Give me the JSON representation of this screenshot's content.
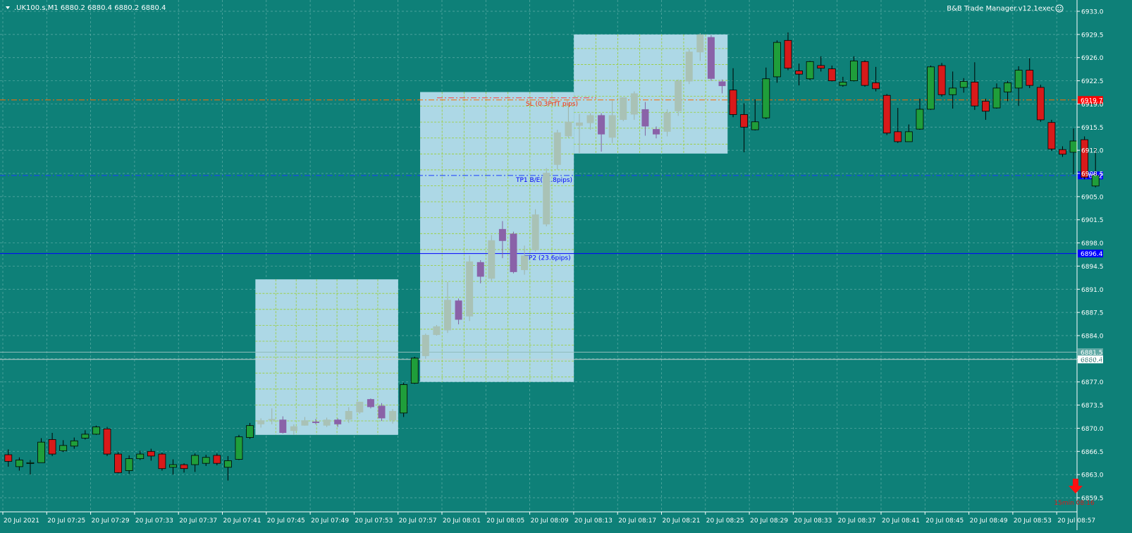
{
  "symbol_header": ".UK100.s,M1  6880.2 6880.4 6880.2 6880.4",
  "indicator_label": "B&B Trade Manager.v12.1exec",
  "price_ticks": [
    "6933.0",
    "6929.5",
    "6926.0",
    "6922.5",
    "6919.0",
    "6915.5",
    "6912.0",
    "6908.5",
    "6905.0",
    "6901.5",
    "6898.0",
    "6894.5",
    "6891.0",
    "6887.5",
    "6884.0",
    "6880.5",
    "6877.0",
    "6873.5",
    "6870.0",
    "6866.5",
    "6863.0",
    "6859.5"
  ],
  "time_labels": [
    "20 Jul 2021",
    "20 Jul 07:25",
    "20 Jul 07:29",
    "20 Jul 07:33",
    "20 Jul 07:37",
    "20 Jul 07:41",
    "20 Jul 07:45",
    "20 Jul 07:49",
    "20 Jul 07:53",
    "20 Jul 07:57",
    "20 Jul 08:01",
    "20 Jul 08:05",
    "20 Jul 08:09",
    "20 Jul 08:13",
    "20 Jul 08:17",
    "20 Jul 08:21",
    "20 Jul 08:25",
    "20 Jul 08:29",
    "20 Jul 08:33",
    "20 Jul 08:37",
    "20 Jul 08:41",
    "20 Jul 08:45",
    "20 Jul 08:49",
    "20 Jul 08:53",
    "20 Jul 08:57"
  ],
  "level_lines": [
    {
      "name": "sl-line",
      "price": 6919.6,
      "color": "#ff6a00",
      "style": "dashdot",
      "label": "SL (0.3PrfT pips)",
      "label_color": "#ff2a00",
      "tag": "6919.7",
      "tag_bg": "#ff0000"
    },
    {
      "name": "tp1-line",
      "price": 6908.2,
      "color": "#1a3cff",
      "style": "dashdot",
      "label": "TP1 B/E(11.8pips)",
      "label_color": "#0000ff",
      "tag": "6908.2",
      "tag_bg": "#0000ff"
    },
    {
      "name": "tp2-line",
      "price": 6896.4,
      "color": "#0000ff",
      "style": "solid",
      "label": "TP2 (23.6pips)",
      "label_color": "#0000ff",
      "tag": "6896.4",
      "tag_bg": "#0000ff"
    },
    {
      "name": "ask-line",
      "price": 6881.5,
      "color": "#8fbcbb",
      "style": "solid",
      "label": "",
      "tag": "6881.5",
      "tag_bg": "#5fa8a4"
    },
    {
      "name": "bid-line",
      "price": 6880.4,
      "color": "#c8d0d0",
      "style": "solid",
      "label": "",
      "tag": "6880.4",
      "tag_bg": "#ffffff"
    }
  ],
  "timer_text": "15min 08:16",
  "colors": {
    "background": "#0e8078",
    "bull": "#1f9e3a",
    "bear": "#d81a1a",
    "zone_fill": "#add8e6",
    "zone_bull": "#a9c2b6",
    "zone_bear": "#8a62a8",
    "axis_text": "#ffffff",
    "grid": "#9fd2ce",
    "zone_grid": "#9acd32"
  },
  "chart_data": {
    "type": "candlestick",
    "symbol": ".UK100.s",
    "timeframe": "M1",
    "ylim": [
      6859.5,
      6933.0
    ],
    "first_time": "07:22",
    "zones": [
      {
        "from": "07:45",
        "to": "07:57",
        "low": 6869.0,
        "high": 6892.5
      },
      {
        "from": "08:00",
        "to": "08:13",
        "low": 6877.0,
        "high": 6920.8
      },
      {
        "from": "08:14",
        "to": "08:27",
        "low": 6911.5,
        "high": 6929.5
      }
    ],
    "candles": [
      [
        6866,
        6865,
        6866.8,
        6864.2
      ],
      [
        6864.2,
        6865.2,
        6865.6,
        6863.6
      ],
      [
        6864.8,
        6864.8,
        6865.2,
        6863
      ],
      [
        6864.8,
        6867.9,
        6868.5,
        6864.8
      ],
      [
        6868.3,
        6866.1,
        6869.3,
        6865.8
      ],
      [
        6866.6,
        6867.4,
        6868.2,
        6866.4
      ],
      [
        6867.3,
        6868.1,
        6868.6,
        6866.9
      ],
      [
        6868.5,
        6869.1,
        6869.7,
        6868.3
      ],
      [
        6869.1,
        6870.2,
        6870.4,
        6869
      ],
      [
        6869.9,
        6866.1,
        6870.2,
        6865.8
      ],
      [
        6866.1,
        6863.3,
        6866.4,
        6863.2
      ],
      [
        6863.6,
        6865.4,
        6865.9,
        6863.1
      ],
      [
        6865.4,
        6866.1,
        6866.6,
        6865.2
      ],
      [
        6866.5,
        6865.8,
        6866.9,
        6865.1
      ],
      [
        6866.1,
        6863.9,
        6866.3,
        6863.6
      ],
      [
        6864.1,
        6864.5,
        6865.3,
        6863
      ],
      [
        6864.5,
        6863.9,
        6864.7,
        6863.3
      ],
      [
        6864.5,
        6865.9,
        6866.2,
        6863.4
      ],
      [
        6864.7,
        6865.6,
        6866,
        6864.3
      ],
      [
        6865.9,
        6864.7,
        6866.2,
        6864.4
      ],
      [
        6864.1,
        6865.1,
        6865.8,
        6862.1
      ],
      [
        6865.3,
        6868.7,
        6869,
        6865.2
      ],
      [
        6868.6,
        6870.4,
        6870.8,
        6868.4
      ],
      [
        6870.6,
        6871.2,
        6871.5,
        6870.1
      ],
      [
        6871.2,
        6871.4,
        6873,
        6870.6
      ],
      [
        6871.3,
        6869.3,
        6871.8,
        6869.2
      ],
      [
        6869.6,
        6870.3,
        6870.6,
        6869
      ],
      [
        6870.4,
        6871.2,
        6871.7,
        6870.4
      ],
      [
        6871,
        6870.8,
        6871.4,
        6870.6
      ],
      [
        6870.4,
        6871.3,
        6871.6,
        6870.2
      ],
      [
        6871.3,
        6870.6,
        6871.5,
        6870.2
      ],
      [
        6871.3,
        6872.6,
        6873.2,
        6870.8
      ],
      [
        6872.4,
        6874,
        6874,
        6872.2
      ],
      [
        6874.4,
        6873.2,
        6874.5,
        6873
      ],
      [
        6873.4,
        6871.5,
        6873.8,
        6871.1
      ],
      [
        6871.2,
        6872.6,
        6872.9,
        6870.7
      ],
      [
        6872.3,
        6876.6,
        6876.9,
        6871.7
      ],
      [
        6876.8,
        6880.6,
        6880.8,
        6876.7
      ],
      [
        6880.9,
        6884.1,
        6884.3,
        6880.5
      ],
      [
        6884.1,
        6885.4,
        6885.6,
        6884
      ],
      [
        6884.8,
        6889.4,
        6892.1,
        6884.4
      ],
      [
        6889.3,
        6886.4,
        6889.6,
        6885.7
      ],
      [
        6886.9,
        6895.2,
        6896.1,
        6886.2
      ],
      [
        6895.1,
        6892.9,
        6895.4,
        6891.9
      ],
      [
        6892.6,
        6898.4,
        6899.2,
        6892.3
      ],
      [
        6900.1,
        6898.3,
        6901.3,
        6895.7
      ],
      [
        6899.4,
        6893.6,
        6899.7,
        6893.4
      ],
      [
        6893.9,
        6896.1,
        6897.6,
        6893.2
      ],
      [
        6896.9,
        6902.3,
        6903.1,
        6896.7
      ],
      [
        6900.8,
        6908.6,
        6909.3,
        6900.5
      ],
      [
        6909.8,
        6914.7,
        6915.1,
        6909.1
      ],
      [
        6914.1,
        6916.3,
        6919.1,
        6913.9
      ],
      [
        6915.7,
        6916.2,
        6917.5,
        6911.6
      ],
      [
        6916.1,
        6917.3,
        6917.6,
        6915.1
      ],
      [
        6917.3,
        6914.4,
        6917.6,
        6911.8
      ],
      [
        6913.9,
        6917.3,
        6919.5,
        6913.1
      ],
      [
        6916.6,
        6920,
        6920,
        6916.4
      ],
      [
        6917.4,
        6920.6,
        6920.9,
        6916.6
      ],
      [
        6918.2,
        6915.6,
        6919.3,
        6914.2
      ],
      [
        6915.2,
        6914.4,
        6915.6,
        6913.8
      ],
      [
        6914.8,
        6917.7,
        6918.2,
        6914.1
      ],
      [
        6917.9,
        6922.5,
        6922.7,
        6917.2
      ],
      [
        6922.4,
        6926.9,
        6927.3,
        6922
      ],
      [
        6926.8,
        6929.5,
        6929.7,
        6925.5
      ],
      [
        6929.1,
        6922.8,
        6929.4,
        6922.5
      ],
      [
        6922.4,
        6921.7,
        6922.7,
        6920.6
      ],
      [
        6921.1,
        6917.4,
        6924.4,
        6917
      ],
      [
        6917.4,
        6915.5,
        6919.1,
        6911.7
      ],
      [
        6915.1,
        6916.3,
        6919.7,
        6915
      ],
      [
        6916.9,
        6922.8,
        6924.5,
        6916.7
      ],
      [
        6923.1,
        6928.3,
        6928.6,
        6922.2
      ],
      [
        6928.6,
        6924.4,
        6929.8,
        6924.1
      ],
      [
        6924,
        6923.5,
        6925.1,
        6921.8
      ],
      [
        6922.8,
        6925.4,
        6925.5,
        6922.6
      ],
      [
        6924.8,
        6924.4,
        6926.2,
        6923.9
      ],
      [
        6924.3,
        6922.5,
        6924.8,
        6922.4
      ],
      [
        6921.8,
        6922.3,
        6923.1,
        6921.6
      ],
      [
        6922.5,
        6925.5,
        6926.2,
        6922.4
      ],
      [
        6925.4,
        6921.8,
        6925.6,
        6921.6
      ],
      [
        6922.2,
        6921.3,
        6924.6,
        6920.9
      ],
      [
        6920.3,
        6914.6,
        6920.5,
        6914.3
      ],
      [
        6914.8,
        6913.3,
        6918.4,
        6913.1
      ],
      [
        6913.3,
        6914.8,
        6915.9,
        6913.3
      ],
      [
        6915.2,
        6918.2,
        6919.8,
        6915.1
      ],
      [
        6918.2,
        6924.6,
        6924.8,
        6918.1
      ],
      [
        6924.8,
        6920.4,
        6925.2,
        6920.1
      ],
      [
        6920.4,
        6921.4,
        6923.9,
        6918.3
      ],
      [
        6921.5,
        6922.4,
        6922.9,
        6920.7
      ],
      [
        6922.3,
        6918.7,
        6925.3,
        6918.1
      ],
      [
        6919.4,
        6917.9,
        6919.8,
        6916.6
      ],
      [
        6918.4,
        6921.4,
        6922.1,
        6918.3
      ],
      [
        6920.8,
        6922.2,
        6922.5,
        6919.4
      ],
      [
        6921.4,
        6924.1,
        6924.7,
        6918.7
      ],
      [
        6924.1,
        6921.8,
        6925.9,
        6921.4
      ],
      [
        6921.5,
        6916.6,
        6921.9,
        6916.3
      ],
      [
        6916.2,
        6912.2,
        6916.6,
        6911.9
      ],
      [
        6912.1,
        6911.4,
        6912.6,
        6911
      ],
      [
        6911.7,
        6913.4,
        6915.3,
        6908.4
      ],
      [
        6913.6,
        6907.9,
        6914.1,
        6907.6
      ],
      [
        6906.6,
        6908.2,
        6912.4,
        6906.4
      ]
    ]
  }
}
